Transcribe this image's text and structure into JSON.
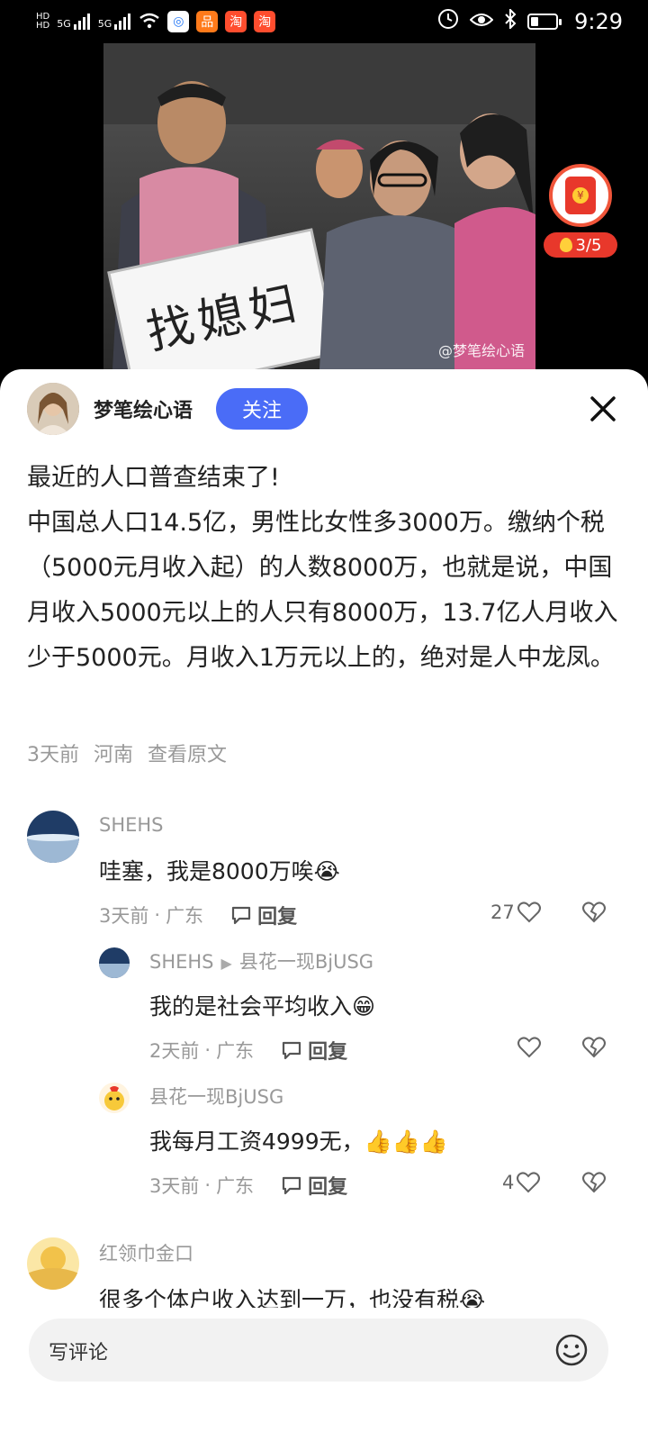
{
  "status_bar": {
    "time": "9:29",
    "net1": "5G",
    "net2": "5G",
    "hd": "HD",
    "apps": [
      "淘",
      "淘"
    ],
    "icons": [
      "signal-icon",
      "wifi-icon",
      "alarm-icon",
      "eye-icon",
      "bluetooth-icon",
      "battery-icon"
    ]
  },
  "photo": {
    "board_text": "找媳妇",
    "watermark": "@梦笔绘心语"
  },
  "reward": {
    "progress": "3/5",
    "progress_value": 0.6,
    "coin": "¥"
  },
  "author": {
    "name": "梦笔绘心语",
    "follow_label": "关注"
  },
  "post": {
    "text": "最近的人口普查结束了!\n中国总人口14.5亿，男性比女性多3000万。缴纳个税（5000元月收入起）的人数8000万，也就是说，中国月收入5000元以上的人只有8000万，13.7亿人月收入少于5000元。月收入1万元以上的，绝对是人中龙凤。",
    "time": "3天前",
    "location": "河南",
    "view_original": "查看原文"
  },
  "comments": [
    {
      "user": "SHEHS",
      "text": "哇塞，我是8000万唉",
      "emoji": "😭",
      "time": "3天前",
      "location": "广东",
      "reply": "回复",
      "likes": "27"
    }
  ],
  "replies": [
    {
      "user": "SHEHS",
      "to": "县花一现BjUSG",
      "text": "我的是社会平均收入",
      "emoji": "😁",
      "time": "2天前",
      "location": "广东",
      "reply": "回复",
      "likes": ""
    },
    {
      "user": "县花一现BjUSG",
      "text": "我每月工资4999无，",
      "emoji": "👍👍👍",
      "time": "3天前",
      "location": "广东",
      "reply": "回复",
      "likes": "4"
    }
  ],
  "comment2": {
    "user": "红领巾金口",
    "text": "很多个体户收入达到一万，也没有税",
    "emoji": "😭"
  },
  "input": {
    "placeholder": "写评论"
  },
  "separator": "·"
}
